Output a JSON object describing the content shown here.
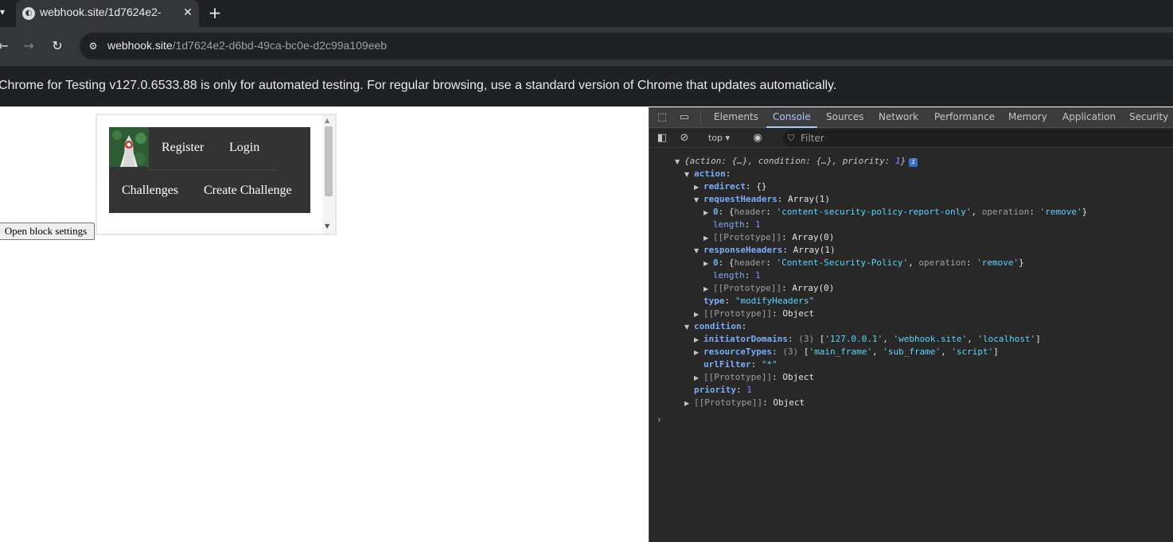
{
  "browser": {
    "tab_title": "webhook.site/1d7624e2-",
    "tab_favicon": "webhook-favicon-icon",
    "url_host": "webhook.site",
    "url_path": "/1d7624e2-d6bd-49ca-bc0e-d2c99a109eeb",
    "info_bar": "Chrome for Testing v127.0.6533.88 is only for automated testing. For regular browsing, use a standard version of Chrome that updates automatically."
  },
  "page": {
    "nav": {
      "register": "Register",
      "login": "Login",
      "challenges": "Challenges",
      "create_challenge": "Create Challenge"
    },
    "block_settings": "Open block settings"
  },
  "devtools": {
    "tabs": [
      "Elements",
      "Console",
      "Sources",
      "Network",
      "Performance",
      "Memory",
      "Application",
      "Security"
    ],
    "context": "top",
    "filter_placeholder": "Filter",
    "console": {
      "summary": {
        "action": "action",
        "action_val": "{…}",
        "condition": "condition",
        "condition_val": "{…}",
        "priority": "priority",
        "priority_val": "1"
      },
      "action": "action",
      "redirect": "redirect",
      "redirect_val": "{}",
      "requestHeaders": "requestHeaders",
      "requestHeaders_val": "Array(1)",
      "rq0_index": "0",
      "rq0_header_key": "header",
      "rq0_header": "'content-security-policy-report-only'",
      "rq0_op_key": "operation",
      "rq0_op": "'remove'",
      "length_key": "length",
      "length_val": "1",
      "proto_key": "[[Prototype]]",
      "proto_array": "Array(0)",
      "responseHeaders": "responseHeaders",
      "responseHeaders_val": "Array(1)",
      "rs0_index": "0",
      "rs0_header": "'Content-Security-Policy'",
      "rs0_op": "'remove'",
      "type_key": "type",
      "type_val": "\"modifyHeaders\"",
      "proto_object": "Object",
      "condition": "condition",
      "initiatorDomains": "initiatorDomains",
      "initiator_count": "(3)",
      "initiator_vals": [
        "'127.0.0.1'",
        "'webhook.site'",
        "'localhost'"
      ],
      "resourceTypes": "resourceTypes",
      "resource_count": "(3)",
      "resource_vals": [
        "'main_frame'",
        "'sub_frame'",
        "'script'"
      ],
      "urlFilter_key": "urlFilter",
      "urlFilter_val": "\"*\"",
      "priority_key": "priority",
      "priority_val": "1"
    }
  }
}
